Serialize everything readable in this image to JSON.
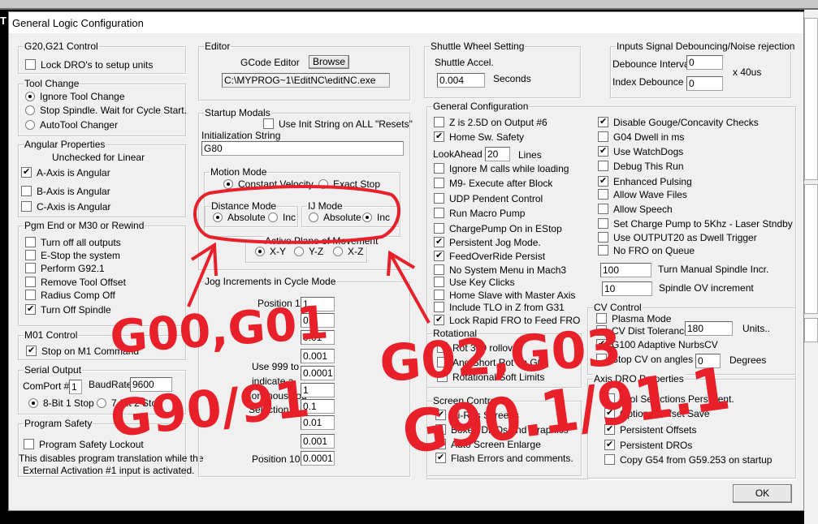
{
  "title": "General Logic Configuration",
  "g20": {
    "title": "G20,G21 Control",
    "items": [
      {
        "label": "Lock DRO's to setup units",
        "checked": false
      }
    ]
  },
  "tool_change": {
    "title": "Tool Change",
    "options": [
      {
        "label": "Ignore Tool Change",
        "selected": true
      },
      {
        "label": "Stop Spindle. Wait for Cycle Start.",
        "selected": false
      },
      {
        "label": "AutoTool Changer",
        "selected": false
      }
    ]
  },
  "angular": {
    "title": "Angular Properties",
    "note": "Unchecked for Linear",
    "items": [
      {
        "label": "A-Axis is Angular",
        "checked": true
      },
      {
        "label": "B-Axis is Angular",
        "checked": false
      },
      {
        "label": "C-Axis is Angular",
        "checked": false
      }
    ]
  },
  "pgm_end": {
    "title": "Pgm End or M30 or Rewind",
    "items": [
      {
        "label": "Turn off all outputs",
        "checked": false
      },
      {
        "label": "E-Stop the system",
        "checked": false
      },
      {
        "label": "Perform G92.1",
        "checked": false
      },
      {
        "label": "Remove Tool Offset",
        "checked": false
      },
      {
        "label": "Radius Comp Off",
        "checked": false
      },
      {
        "label": "Turn Off Spindle",
        "checked": true
      }
    ]
  },
  "m01": {
    "title": "M01 Control",
    "items": [
      {
        "label": "Stop on M1 Command",
        "checked": true
      }
    ]
  },
  "serial": {
    "title": "Serial Output",
    "comport_label": "ComPort #",
    "comport": "1",
    "baud_label": "BaudRate",
    "baud": "9600",
    "options": [
      {
        "label": "8-Bit 1 Stop",
        "selected": true
      },
      {
        "label": "7-Bit 2 Stop",
        "selected": false
      }
    ]
  },
  "safety": {
    "title": "Program Safety",
    "items": [
      {
        "label": "Program Safety Lockout",
        "checked": false
      }
    ],
    "desc1": "This disables program translation while the",
    "desc2": "External Activation #1 input is activated."
  },
  "editor": {
    "title": "Editor",
    "label": "GCode Editor",
    "browse": "Browse",
    "path": "C:\\MYPROG~1\\EditNC\\editNC.exe"
  },
  "startup": {
    "title": "Startup Modals",
    "use_init": {
      "items": [
        {
          "label": "Use Init String on ALL  \"Resets\"",
          "checked": false
        }
      ]
    },
    "init_label": "Initialization String",
    "init_value": "G80",
    "motion": {
      "title": "Motion Mode",
      "options": [
        {
          "label": "Constant Velocity",
          "selected": true
        },
        {
          "label": "Exact Stop",
          "selected": false
        }
      ]
    },
    "distance": {
      "title": "Distance Mode",
      "options": [
        {
          "label": "Absolute",
          "selected": true
        },
        {
          "label": "Inc",
          "selected": false
        }
      ]
    },
    "ij": {
      "title": "IJ Mode",
      "options": [
        {
          "label": "Absolute",
          "selected": false
        },
        {
          "label": "Inc",
          "selected": true
        }
      ]
    },
    "plane": {
      "title": "Active Plane of Movement",
      "options": [
        {
          "label": "X-Y",
          "selected": true
        },
        {
          "label": "Y-Z",
          "selected": false
        },
        {
          "label": "X-Z",
          "selected": false
        }
      ]
    }
  },
  "jog": {
    "title": "Jog Increments in Cycle Mode",
    "first_label": "Position 1",
    "last_label": "Position 10",
    "note": [
      "Use 999 to",
      "indicate a",
      "Continous Jog",
      "Selection."
    ],
    "values": [
      "1",
      "0.1",
      "0.01",
      "0.001",
      "0.0001",
      "1",
      "0.1",
      "0.01",
      "0.001",
      "0.0001"
    ]
  },
  "shuttle": {
    "title": "Shuttle Wheel Setting",
    "label": "Shuttle Accel.",
    "value": "0.004",
    "unit": "Seconds"
  },
  "debounce": {
    "title": "Inputs Signal Debouncing/Noise rejection",
    "interval_label": "Debounce Interval:",
    "interval": "0",
    "index_label": "Index Debounce",
    "index": "0",
    "unit": "x 40us"
  },
  "general": {
    "title": "General Configuration",
    "left_top": [
      {
        "label": "Z is 2.5D on Output #6",
        "checked": false
      },
      {
        "label": "Home Sw. Safety",
        "checked": true
      }
    ],
    "lookahead": {
      "label": "LookAhead",
      "value": "20",
      "unit": "Lines"
    },
    "left": [
      {
        "label": "Ignore M calls while loading",
        "checked": false
      },
      {
        "label": "M9- Execute after Block",
        "checked": false
      },
      {
        "label": "UDP Pendent Control",
        "checked": false
      },
      {
        "label": "Run Macro Pump",
        "checked": false
      },
      {
        "label": "ChargePump On in EStop",
        "checked": false
      },
      {
        "label": "Persistent Jog Mode.",
        "checked": true
      },
      {
        "label": "FeedOverRide Persist",
        "checked": true
      },
      {
        "label": "No System Menu in Mach3",
        "checked": false
      },
      {
        "label": "Use Key Clicks",
        "checked": false
      },
      {
        "label": "Home Slave with Master Axis",
        "checked": false
      },
      {
        "label": "Include TLO in Z from G31",
        "checked": false
      },
      {
        "label": "Lock Rapid FRO to Feed FRO",
        "checked": true
      }
    ],
    "right": [
      {
        "label": "Disable Gouge/Concavity Checks",
        "checked": true
      },
      {
        "label": "G04 Dwell in ms",
        "checked": false
      },
      {
        "label": "Use WatchDogs",
        "checked": true
      },
      {
        "label": "Debug This Run",
        "checked": false
      },
      {
        "label": "Enhanced Pulsing",
        "checked": true
      },
      {
        "label": "Allow Wave Files",
        "checked": false
      },
      {
        "label": "Allow Speech",
        "checked": false
      },
      {
        "label": "Set Charge Pump to 5Khz  - Laser Stndby",
        "checked": false
      },
      {
        "label": "Use OUTPUT20 as Dwell Trigger",
        "checked": false
      },
      {
        "label": "No FRO on Queue",
        "checked": false
      }
    ],
    "spindle_incr": {
      "value": "100",
      "label": "Turn Manual Spindle Incr."
    },
    "spindle_ov": {
      "value": "10",
      "label": "Spindle OV increment"
    }
  },
  "rotational": {
    "title": "Rotational",
    "items": [
      {
        "label": "Rot 360 rollover",
        "checked": false
      },
      {
        "label": "Ang Short Rot on G0",
        "checked": false
      },
      {
        "label": "Rotational Soft Limits",
        "checked": false
      }
    ]
  },
  "screen": {
    "title": "Screen Control",
    "items": [
      {
        "label": "Hi-Res Screens",
        "checked": true
      },
      {
        "label": "Boxed DROs and Graphics",
        "checked": false
      },
      {
        "label": "Auto Screen Enlarge",
        "checked": false
      },
      {
        "label": "Flash Errors and comments.",
        "checked": true
      }
    ]
  },
  "cv": {
    "title": "CV Control",
    "items": [
      {
        "label": "Plasma Mode",
        "checked": false
      },
      {
        "label": "CV Dist Tolerance",
        "checked": false
      },
      {
        "label": "G100 Adaptive NurbsCV",
        "checked": true
      },
      {
        "label": "Stop CV on angles >",
        "checked": false
      }
    ],
    "dist_value": "180",
    "dist_unit": "Units..",
    "angle_value": "0",
    "angle_unit": "Degrees"
  },
  "axis_dro": {
    "title": "Axis DRO Properties",
    "items": [
      {
        "label": "Tool Selections Persistent.",
        "checked": false
      },
      {
        "label": "Optional Offset Save",
        "checked": true
      },
      {
        "label": "Persistent Offsets",
        "checked": true
      },
      {
        "label": "Persistent DROs",
        "checked": true
      },
      {
        "label": "Copy G54 from G59.253 on startup",
        "checked": false
      }
    ]
  },
  "ok_label": "OK",
  "annotations": {
    "color": "#e8202a",
    "texts": [
      "G00,G01",
      "G90/91",
      "G02,G03",
      "G90.1/91.1"
    ]
  }
}
